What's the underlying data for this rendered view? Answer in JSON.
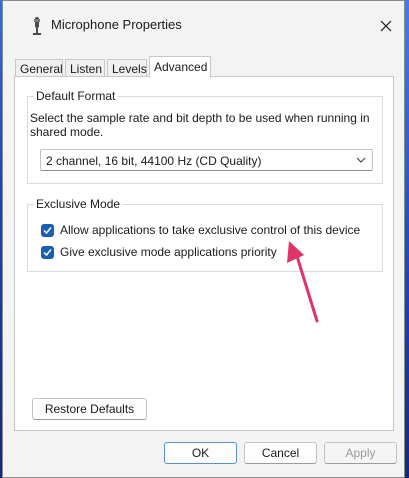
{
  "window": {
    "title": "Microphone Properties"
  },
  "tabs": [
    {
      "label": "General"
    },
    {
      "label": "Listen"
    },
    {
      "label": "Levels"
    },
    {
      "label": "Advanced",
      "active": true
    }
  ],
  "default_format": {
    "legend": "Default Format",
    "description": "Select the sample rate and bit depth to be used when running in shared mode.",
    "selected": "2 channel, 16 bit, 44100 Hz (CD Quality)"
  },
  "exclusive_mode": {
    "legend": "Exclusive Mode",
    "options": [
      {
        "label": "Allow applications to take exclusive control of this device",
        "checked": true
      },
      {
        "label": "Give exclusive mode applications priority",
        "checked": true
      }
    ]
  },
  "buttons": {
    "restore_defaults": "Restore Defaults",
    "ok": "OK",
    "cancel": "Cancel",
    "apply": "Apply"
  },
  "colors": {
    "accent": "#1a5fb4",
    "annotation_arrow": "#e0336a"
  },
  "icons": {
    "window": "microphone-icon",
    "close": "close-icon",
    "dropdown": "chevron-down-icon",
    "checkbox": "checkmark-icon"
  }
}
